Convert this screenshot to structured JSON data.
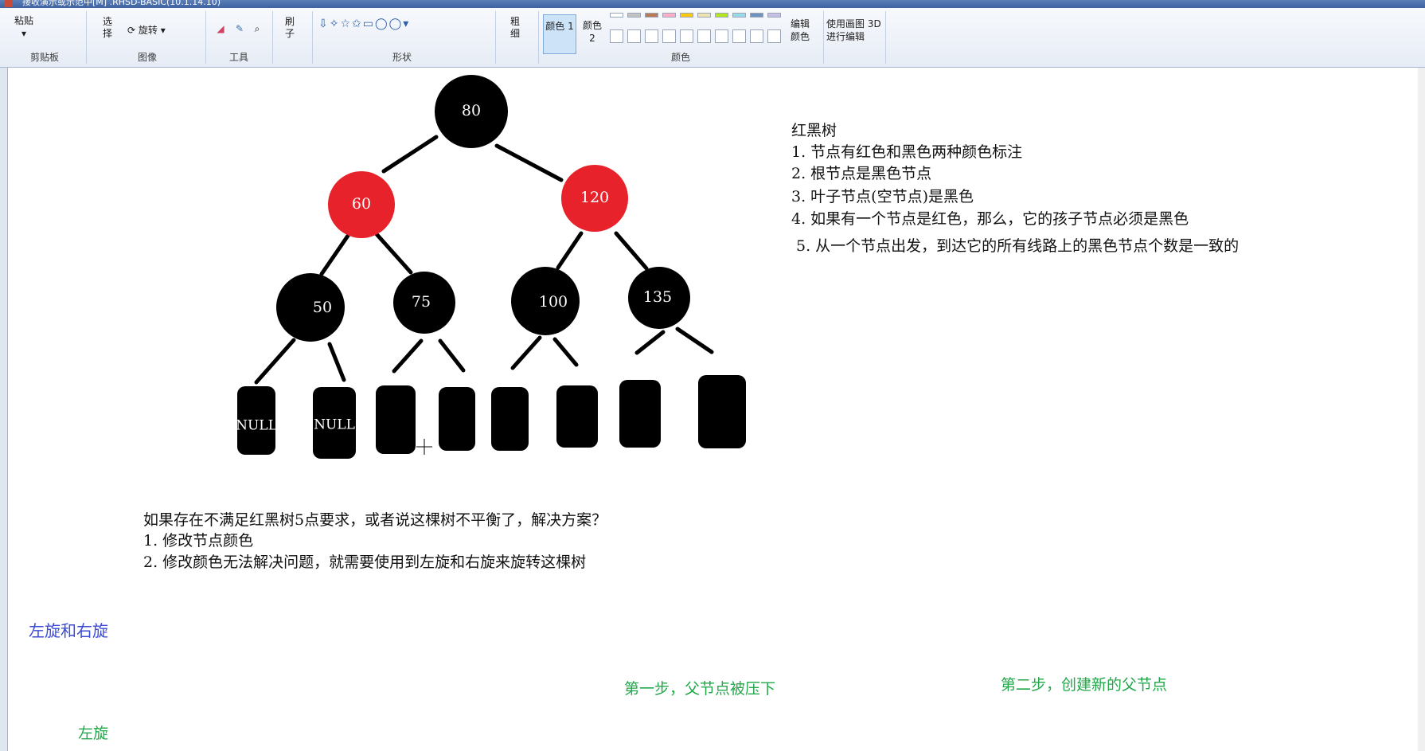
{
  "window": {
    "title": "接收演示或示范中[M] .RHSD-BASIC(10.1.14.10)"
  },
  "ribbon": {
    "paste": "粘贴",
    "select": "选择",
    "rotate": "旋转",
    "brush": "刷子",
    "size": "粗细",
    "color1": "颜色 1",
    "color2": "颜色 2",
    "edit_colors": "编辑颜色",
    "paint3d": "使用画图 3D 进行编辑",
    "groups": {
      "clipboard": "剪贴板",
      "image": "图像",
      "tools": "工具",
      "shapes": "形状",
      "colors": "颜色"
    },
    "palette": [
      "#ffffff",
      "#c3c3c3",
      "#b97a57",
      "#ffaec9",
      "#ffc90e",
      "#efe4b0",
      "#b5e61d",
      "#99d9ea",
      "#7092be",
      "#c8bfe7"
    ]
  },
  "tree": {
    "nodes": [
      {
        "label": "80",
        "color": "#000000"
      },
      {
        "label": "60",
        "color": "#e8222a"
      },
      {
        "label": "120",
        "color": "#e8222a"
      },
      {
        "label": "50",
        "color": "#000000"
      },
      {
        "label": "75",
        "color": "#000000"
      },
      {
        "label": "100",
        "color": "#000000"
      },
      {
        "label": "135",
        "color": "#000000"
      }
    ],
    "leaves": [
      "NULL",
      "NULL",
      "",
      "",
      "",
      "",
      "",
      ""
    ]
  },
  "rules": {
    "title": "红黑树",
    "items": [
      "1.  节点有红色和黑色两种颜色标注",
      "2.  根节点是黑色节点",
      "3.  叶子节点(空节点)是黑色",
      "4.  如果有一个节点是红色，那么，它的孩子节点必须是黑色",
      "5.  从一个节点出发，到达它的所有线路上的黑色节点个数是一致的"
    ]
  },
  "solution": {
    "question": "如果存在不满足红黑树5点要求，或者说这棵树不平衡了，解决方案？",
    "items": [
      "1.  修改节点颜色",
      "2.  修改颜色无法解决问题，就需要使用到左旋和右旋来旋转这棵树"
    ]
  },
  "rotation": {
    "heading": "左旋和右旋",
    "step1": "第一步，父节点被压下",
    "step2": "第二步，创建新的父节点",
    "left": "左旋"
  }
}
